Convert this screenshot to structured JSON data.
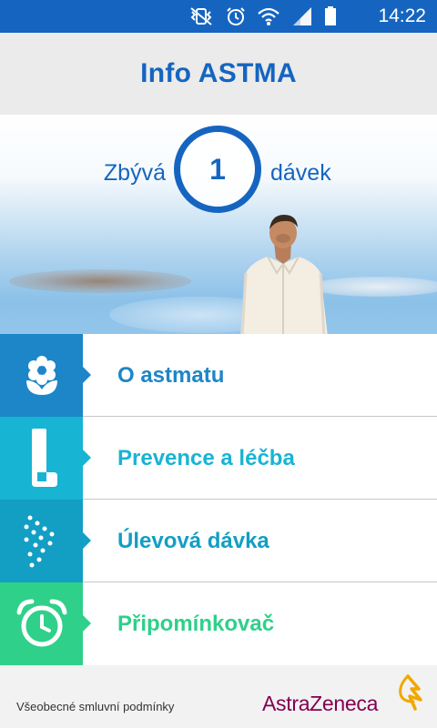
{
  "status_bar": {
    "time": "14:22",
    "icons": [
      "vibrate-mute-icon",
      "alarm-icon",
      "wifi-icon",
      "signal-icon",
      "battery-icon"
    ]
  },
  "header": {
    "title": "Info ASTMA"
  },
  "dose_counter": {
    "prefix": "Zbývá",
    "count": "1",
    "suffix": "dávek"
  },
  "menu": {
    "items": [
      {
        "label": "O astmatu",
        "icon": "flower-icon",
        "color": "#1c86c8"
      },
      {
        "label": "Prevence a léčba",
        "icon": "inhaler-icon",
        "color": "#18b4d4"
      },
      {
        "label": "Úlevová dávka",
        "icon": "spray-dots-icon",
        "color": "#139ec4"
      },
      {
        "label": "Připomínkovač",
        "icon": "alarm-clock-icon",
        "color": "#2ed08a"
      }
    ]
  },
  "footer": {
    "terms_link": "Všeobecné smluvní podmínky",
    "brand": "AstraZeneca"
  },
  "colors": {
    "primary": "#1565c0",
    "header_bg": "#ebebeb",
    "brand": "#830051"
  }
}
